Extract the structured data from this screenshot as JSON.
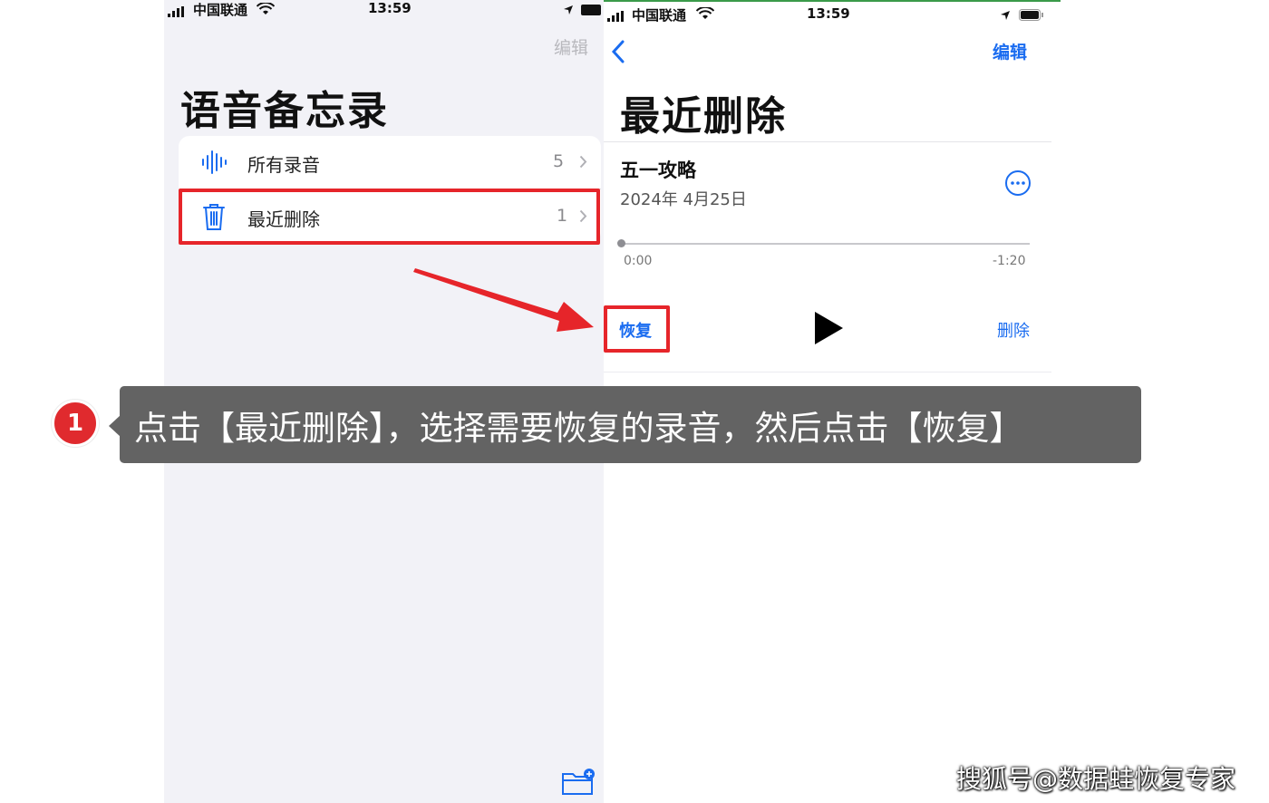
{
  "left_screen": {
    "status": {
      "carrier": "中国联通",
      "time": "13:59"
    },
    "edit_label": "编辑",
    "title": "语音备忘录",
    "rows": [
      {
        "label": "所有录音",
        "count": "5",
        "icon": "waveform-icon"
      },
      {
        "label": "最近删除",
        "count": "1",
        "icon": "trash-icon"
      }
    ],
    "folder_icon": "new-folder-icon"
  },
  "right_screen": {
    "status": {
      "carrier": "中国联通",
      "time": "13:59"
    },
    "back_icon": "chevron-left-icon",
    "edit_label": "编辑",
    "title": "最近删除",
    "recording": {
      "name": "五一攻略",
      "date": "2024年 4月25日",
      "elapsed": "0:00",
      "remaining": "-1:20",
      "progress": 0
    },
    "actions": {
      "restore": "恢复",
      "delete": "删除"
    }
  },
  "annotation": {
    "step": "1",
    "text": "点击【最近删除】，选择需要恢复的录音，然后点击【恢复】"
  },
  "watermark": "搜狐号@数据蛙恢复专家",
  "colors": {
    "accent": "#1a6cf0",
    "highlight": "#e6252a",
    "callout_bg": "#636363"
  }
}
